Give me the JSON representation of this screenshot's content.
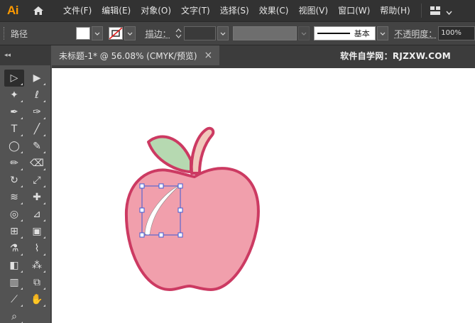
{
  "app": {
    "logo_text": "Ai"
  },
  "menu": {
    "items": [
      "文件(F)",
      "编辑(E)",
      "对象(O)",
      "文字(T)",
      "选择(S)",
      "效果(C)",
      "视图(V)",
      "窗口(W)",
      "帮助(H)"
    ]
  },
  "controlbar": {
    "selection_label": "路径",
    "stroke_label": "描边：",
    "brush_label": "基本",
    "opacity_label": "不透明度：",
    "opacity_value": "100%"
  },
  "document": {
    "tab_title": "未标题-1* @ 56.08% (CMYK/预览)",
    "close_glyph": "×",
    "brand_text": "软件自学网：RJZXW.COM"
  },
  "toolbar": {
    "collapse_glyph": "◂◂",
    "tools": [
      {
        "name": "selection-tool",
        "glyph": "▷",
        "active": true
      },
      {
        "name": "direct-selection-tool",
        "glyph": "▶",
        "active": false
      },
      {
        "name": "magic-wand-tool",
        "glyph": "✦",
        "active": false
      },
      {
        "name": "lasso-tool",
        "glyph": "ℓ",
        "active": false
      },
      {
        "name": "pen-tool",
        "glyph": "✒",
        "active": false
      },
      {
        "name": "curvature-tool",
        "glyph": "✑",
        "active": false
      },
      {
        "name": "type-tool",
        "glyph": "T",
        "active": false
      },
      {
        "name": "line-tool",
        "glyph": "╱",
        "active": false
      },
      {
        "name": "ellipse-tool",
        "glyph": "◯",
        "active": false
      },
      {
        "name": "paintbrush-tool",
        "glyph": "✎",
        "active": false
      },
      {
        "name": "shaper-tool",
        "glyph": "✏",
        "active": false
      },
      {
        "name": "eraser-tool",
        "glyph": "⌫",
        "active": false
      },
      {
        "name": "rotate-tool",
        "glyph": "↻",
        "active": false
      },
      {
        "name": "scale-tool",
        "glyph": "⤢",
        "active": false
      },
      {
        "name": "warp-tool",
        "glyph": "≋",
        "active": false
      },
      {
        "name": "puppet-warp-tool",
        "glyph": "✚",
        "active": false
      },
      {
        "name": "shape-builder-tool",
        "glyph": "◎",
        "active": false
      },
      {
        "name": "perspective-grid-tool",
        "glyph": "⊿",
        "active": false
      },
      {
        "name": "mesh-tool",
        "glyph": "⊞",
        "active": false
      },
      {
        "name": "gradient-tool",
        "glyph": "▣",
        "active": false
      },
      {
        "name": "eyedropper-tool",
        "glyph": "⚗",
        "active": false
      },
      {
        "name": "measure-tool",
        "glyph": "⌇",
        "active": false
      },
      {
        "name": "blend-tool",
        "glyph": "◧",
        "active": false
      },
      {
        "name": "symbol-sprayer-tool",
        "glyph": "⁂",
        "active": false
      },
      {
        "name": "column-graph-tool",
        "glyph": "▥",
        "active": false
      },
      {
        "name": "artboard-tool",
        "glyph": "⧉",
        "active": false
      },
      {
        "name": "slice-tool",
        "glyph": "⟋",
        "active": false
      },
      {
        "name": "hand-tool",
        "glyph": "✋",
        "active": false
      },
      {
        "name": "zoom-tool",
        "glyph": "⌕",
        "active": false
      }
    ]
  },
  "colors": {
    "apple_fill": "#f19fac",
    "apple_stroke": "#cc3a62",
    "leaf_fill": "#b6d9b1",
    "stem_fill": "#f1c8bc",
    "selection_blue": "#3b5bd6",
    "highlight_fill": "#ffffff"
  }
}
